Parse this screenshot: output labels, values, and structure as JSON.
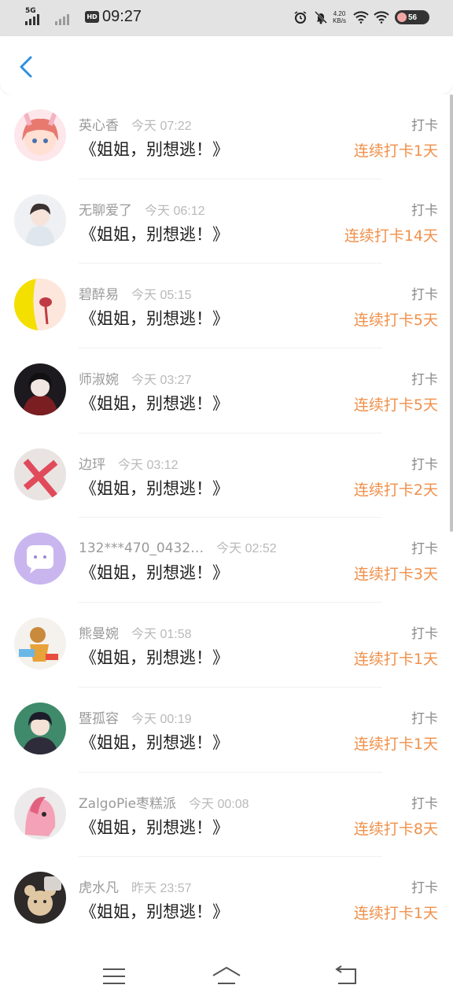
{
  "status_bar": {
    "network": "5G",
    "hd": "HD",
    "time": "09:27",
    "speed_value": "4.20",
    "speed_unit": "KB/s",
    "battery": "56",
    "icons": [
      "signal-icon",
      "alarm-icon",
      "mute-icon",
      "wifi-icon",
      "battery-icon"
    ]
  },
  "header": {
    "back_icon": "chevron-left-icon",
    "accent": "#2f8fe0"
  },
  "list": {
    "items": [
      {
        "name": "英心香",
        "time": "今天 07:22",
        "book": "《姐姐，别想逃！》",
        "action": "打卡",
        "streak": "连续打卡1天"
      },
      {
        "name": "无聊爱了",
        "time": "今天 06:12",
        "book": "《姐姐，别想逃！》",
        "action": "打卡",
        "streak": "连续打卡14天"
      },
      {
        "name": "碧醉易",
        "time": "今天 05:15",
        "book": "《姐姐，别想逃！》",
        "action": "打卡",
        "streak": "连续打卡5天"
      },
      {
        "name": "师淑婉",
        "time": "今天 03:27",
        "book": "《姐姐，别想逃！》",
        "action": "打卡",
        "streak": "连续打卡5天"
      },
      {
        "name": "边玶",
        "time": "今天 03:12",
        "book": "《姐姐，别想逃！》",
        "action": "打卡",
        "streak": "连续打卡2天"
      },
      {
        "name": "132***470_0432…",
        "time": "今天 02:52",
        "book": "《姐姐，别想逃！》",
        "action": "打卡",
        "streak": "连续打卡3天"
      },
      {
        "name": "熊曼婉",
        "time": "今天 01:58",
        "book": "《姐姐，别想逃！》",
        "action": "打卡",
        "streak": "连续打卡1天"
      },
      {
        "name": "暨孤容",
        "time": "今天 00:19",
        "book": "《姐姐，别想逃！》",
        "action": "打卡",
        "streak": "连续打卡1天"
      },
      {
        "name": "ZalgoPie枣糕派",
        "time": "今天 00:08",
        "book": "《姐姐，别想逃！》",
        "action": "打卡",
        "streak": "连续打卡8天"
      },
      {
        "name": "虎水凡",
        "time": "昨天 23:57",
        "book": "《姐姐，别想逃！》",
        "action": "打卡",
        "streak": "连续打卡1天"
      }
    ]
  },
  "colors": {
    "streak": "#f0904a",
    "name": "#9a9a9a",
    "book": "#1f1f1f"
  },
  "navbar": {
    "icons": [
      "menu-icon",
      "home-icon",
      "back-icon"
    ]
  }
}
